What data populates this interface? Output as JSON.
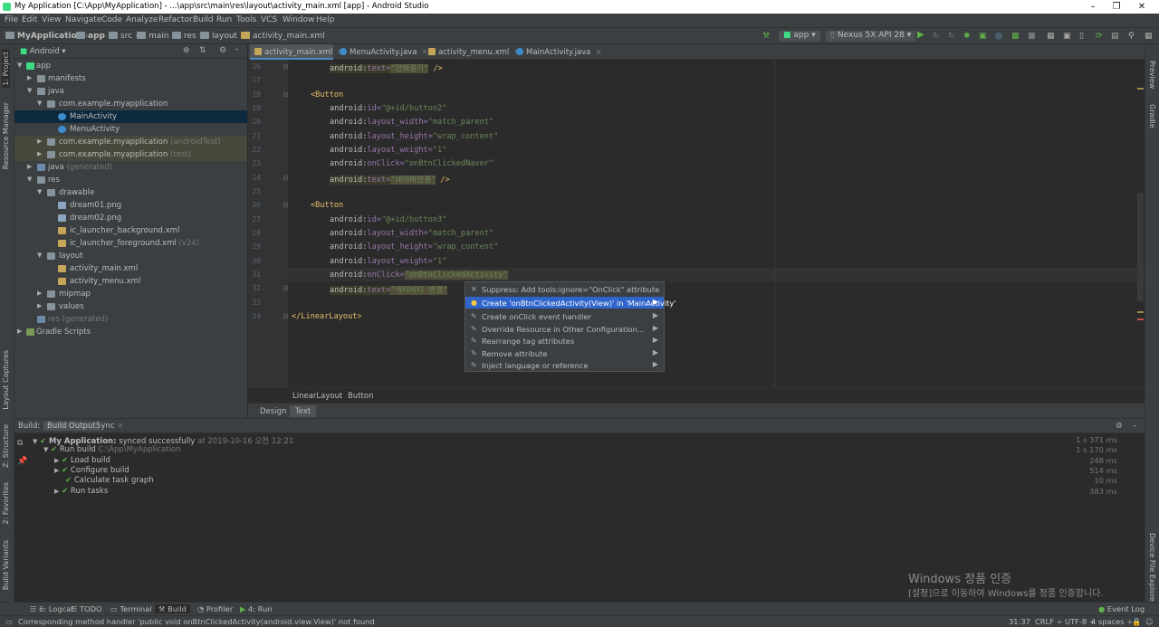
{
  "window": {
    "title": "My Application [C:\\App\\MyApplication] - ...\\app\\src\\main\\res\\layout\\activity_main.xml [app] - Android Studio"
  },
  "menu": [
    "File",
    "Edit",
    "View",
    "Navigate",
    "Code",
    "Analyze",
    "Refactor",
    "Build",
    "Run",
    "Tools",
    "VCS",
    "Window",
    "Help"
  ],
  "navbar": {
    "crumbs": [
      "MyApplication",
      "app",
      "src",
      "main",
      "res",
      "layout",
      "activity_main.xml"
    ],
    "run_config": "app",
    "device": "Nexus 5X API 28"
  },
  "left_stripe": [
    "1: Project",
    "Resource Manager",
    "Layout Captures",
    "Z: Structure",
    "2: Favorites",
    "Build Variants"
  ],
  "right_stripe": [
    "Preview",
    "Gradle",
    "Device File Explorer"
  ],
  "project": {
    "view_mode": "Android",
    "tree": [
      {
        "label": "app",
        "suffix": ""
      },
      {
        "label": "manifests",
        "suffix": ""
      },
      {
        "label": "java",
        "suffix": ""
      },
      {
        "label": "com.example.myapplication",
        "suffix": ""
      },
      {
        "label": "MainActivity",
        "suffix": ""
      },
      {
        "label": "MenuActivity",
        "suffix": ""
      },
      {
        "label": "com.example.myapplication",
        "suffix": "(androidTest)"
      },
      {
        "label": "com.example.myapplication",
        "suffix": "(test)"
      },
      {
        "label": "java",
        "suffix": "(generated)"
      },
      {
        "label": "res",
        "suffix": ""
      },
      {
        "label": "drawable",
        "suffix": ""
      },
      {
        "label": "dream01.png",
        "suffix": ""
      },
      {
        "label": "dream02.png",
        "suffix": ""
      },
      {
        "label": "ic_launcher_background.xml",
        "suffix": ""
      },
      {
        "label": "ic_launcher_foreground.xml",
        "suffix": "(v24)"
      },
      {
        "label": "layout",
        "suffix": ""
      },
      {
        "label": "activity_main.xml",
        "suffix": ""
      },
      {
        "label": "activity_menu.xml",
        "suffix": ""
      },
      {
        "label": "mipmap",
        "suffix": ""
      },
      {
        "label": "values",
        "suffix": ""
      },
      {
        "label": "res",
        "suffix": "(generated)"
      },
      {
        "label": "Gradle Scripts",
        "suffix": ""
      }
    ]
  },
  "editor": {
    "tabs": [
      "activity_main.xml",
      "MenuActivity.java",
      "activity_menu.xml",
      "MainActivity.java"
    ],
    "line_numbers": [
      "16",
      "17",
      "18",
      "19",
      "20",
      "21",
      "22",
      "23",
      "24",
      "25",
      "26",
      "27",
      "28",
      "29",
      "30",
      "31",
      "32",
      "33",
      "34"
    ],
    "lines": [
      {
        "ns": "android:",
        "attr": "text=",
        "val": "\"전화걸기\"",
        "tail": " />"
      },
      {
        "ns": "",
        "attr": "",
        "val": "",
        "tail": ""
      },
      {
        "tag": "<Button"
      },
      {
        "ns": "android:",
        "attr": "id=",
        "val": "\"@+id/button2\"",
        "tail": ""
      },
      {
        "ns": "android:",
        "attr": "layout_width=",
        "val": "\"match_parent\"",
        "tail": ""
      },
      {
        "ns": "android:",
        "attr": "layout_height=",
        "val": "\"wrap_content\"",
        "tail": ""
      },
      {
        "ns": "android:",
        "attr": "layout_weight=",
        "val": "\"1\"",
        "tail": ""
      },
      {
        "ns": "android:",
        "attr": "onClick=",
        "val": "\"onBtnClickedNaver\"",
        "tail": ""
      },
      {
        "ns": "android:",
        "attr": "text=",
        "val": "\"네이버연결\"",
        "tail": " />"
      },
      {
        "ns": "",
        "attr": "",
        "val": "",
        "tail": ""
      },
      {
        "tag": "<Button"
      },
      {
        "ns": "android:",
        "attr": "id=",
        "val": "\"@+id/button3\"",
        "tail": ""
      },
      {
        "ns": "android:",
        "attr": "layout_width=",
        "val": "\"match_parent\"",
        "tail": ""
      },
      {
        "ns": "android:",
        "attr": "layout_height=",
        "val": "\"wrap_content\"",
        "tail": ""
      },
      {
        "ns": "android:",
        "attr": "layout_weight=",
        "val": "\"1\"",
        "tail": ""
      },
      {
        "ns": "android:",
        "attr": "onClick=",
        "val": "\"onBtnClickedActivity\"",
        "tail": ""
      },
      {
        "ns": "android:",
        "attr": "text=",
        "val": "\"액티비티 변경\"",
        "tail": ""
      },
      {
        "ns": "",
        "attr": "",
        "val": "",
        "tail": ""
      },
      {
        "tag": "</LinearLayout>"
      }
    ],
    "breadcrumb": [
      "LinearLayout",
      "Button"
    ],
    "mode_tabs": [
      "Design",
      "Text"
    ]
  },
  "popup": {
    "items": [
      "Suppress: Add tools:ignore=\"OnClick\" attribute",
      "Create 'onBtnClickedActivity(View)' in 'MainActivity'",
      "Create onClick event handler",
      "Override Resource in Other Configuration...",
      "Rearrange tag attributes",
      "Remove attribute",
      "Inject language or reference"
    ],
    "selected_index": 1
  },
  "build": {
    "header": {
      "build": "Build:",
      "output": "Build Output",
      "sync": "Sync"
    },
    "rows": [
      {
        "label": "My Application:",
        "detail": "synced successfully",
        "extra": "at 2019-10-16 오전 12:21",
        "time": "1 s 371 ms"
      },
      {
        "label": "Run build",
        "detail": "C:\\App\\MyApplication",
        "extra": "",
        "time": "1 s 170 ms"
      },
      {
        "label": "Load build",
        "detail": "",
        "extra": "",
        "time": "248 ms"
      },
      {
        "label": "Configure build",
        "detail": "",
        "extra": "",
        "time": "514 ms"
      },
      {
        "label": "Calculate task graph",
        "detail": "",
        "extra": "",
        "time": "10 ms"
      },
      {
        "label": "Run tasks",
        "detail": "",
        "extra": "",
        "time": "383 ms"
      }
    ]
  },
  "toolstripe": [
    "6: Logcat",
    "TODO",
    "Terminal",
    "Build",
    "Profiler",
    "4: Run",
    "Event Log"
  ],
  "status": {
    "message": "Corresponding method handler 'public void onBtnClickedActivity(android.view.View)' not found",
    "position": "31:37",
    "line_sep": "CRLF",
    "encoding": "UTF-8",
    "indent": "4 spaces"
  },
  "watermark": {
    "line1": "Windows 정품 인증",
    "line2": "[설정]으로 이동하여 Windows를 정품 인증합니다."
  },
  "colors": {
    "accent": "#2f65ca",
    "success": "#5fb349",
    "tag": "#e8bf6a",
    "value": "#6a8759"
  }
}
